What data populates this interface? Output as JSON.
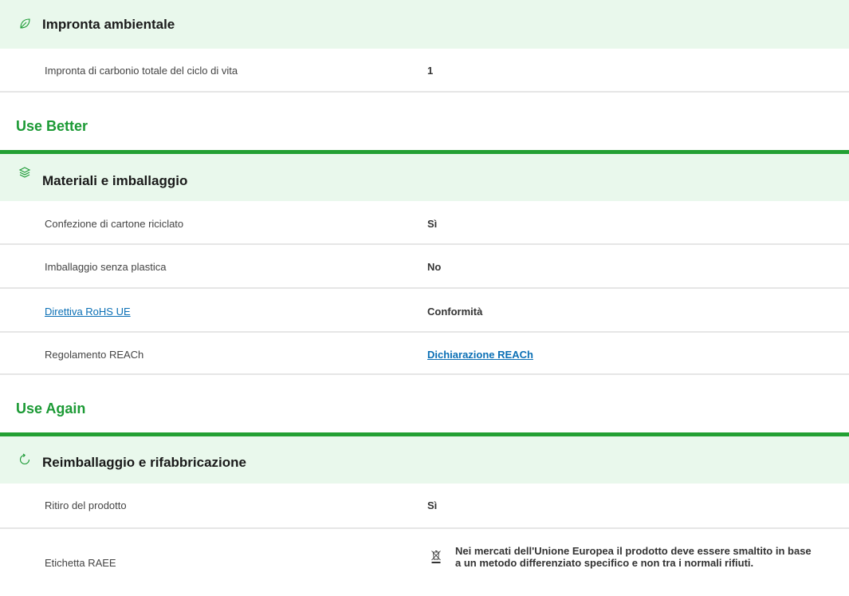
{
  "sections": {
    "footprint": {
      "icon": "leaf-icon",
      "title": "Impronta ambientale",
      "rows": [
        {
          "label": "Impronta di carbonio totale del ciclo di vita",
          "value": "1"
        }
      ]
    },
    "use_better": {
      "category": "Use Better",
      "icon": "layers-icon",
      "title": "Materiali e imballaggio",
      "rows": [
        {
          "label": "Confezione di cartone riciclato",
          "value": "Sì"
        },
        {
          "label": "Imballaggio senza plastica",
          "value": "No"
        },
        {
          "label": "Direttiva RoHS UE",
          "value": "Conformità"
        },
        {
          "label": "Regolamento REACh",
          "value": "Dichiarazione REACh"
        }
      ]
    },
    "use_again": {
      "category": "Use Again",
      "icon": "refresh-icon",
      "title": "Reimballaggio e rifabbricazione",
      "rows": [
        {
          "label": "Ritiro del prodotto",
          "value": "Sì"
        },
        {
          "label": "Etichetta RAEE",
          "value": "Nei mercati dell'Unione Europea il prodotto deve essere smaltito in base a un metodo differenziato specifico e non tra i normali rifiuti.",
          "icon": "weee-bin-icon"
        }
      ]
    }
  },
  "colors": {
    "header_bg": "#e9f8ec",
    "accent_green": "#23a033",
    "category_green": "#1c9a35",
    "link_blue": "#0a6fb5",
    "divider": "#e6e6e6"
  }
}
